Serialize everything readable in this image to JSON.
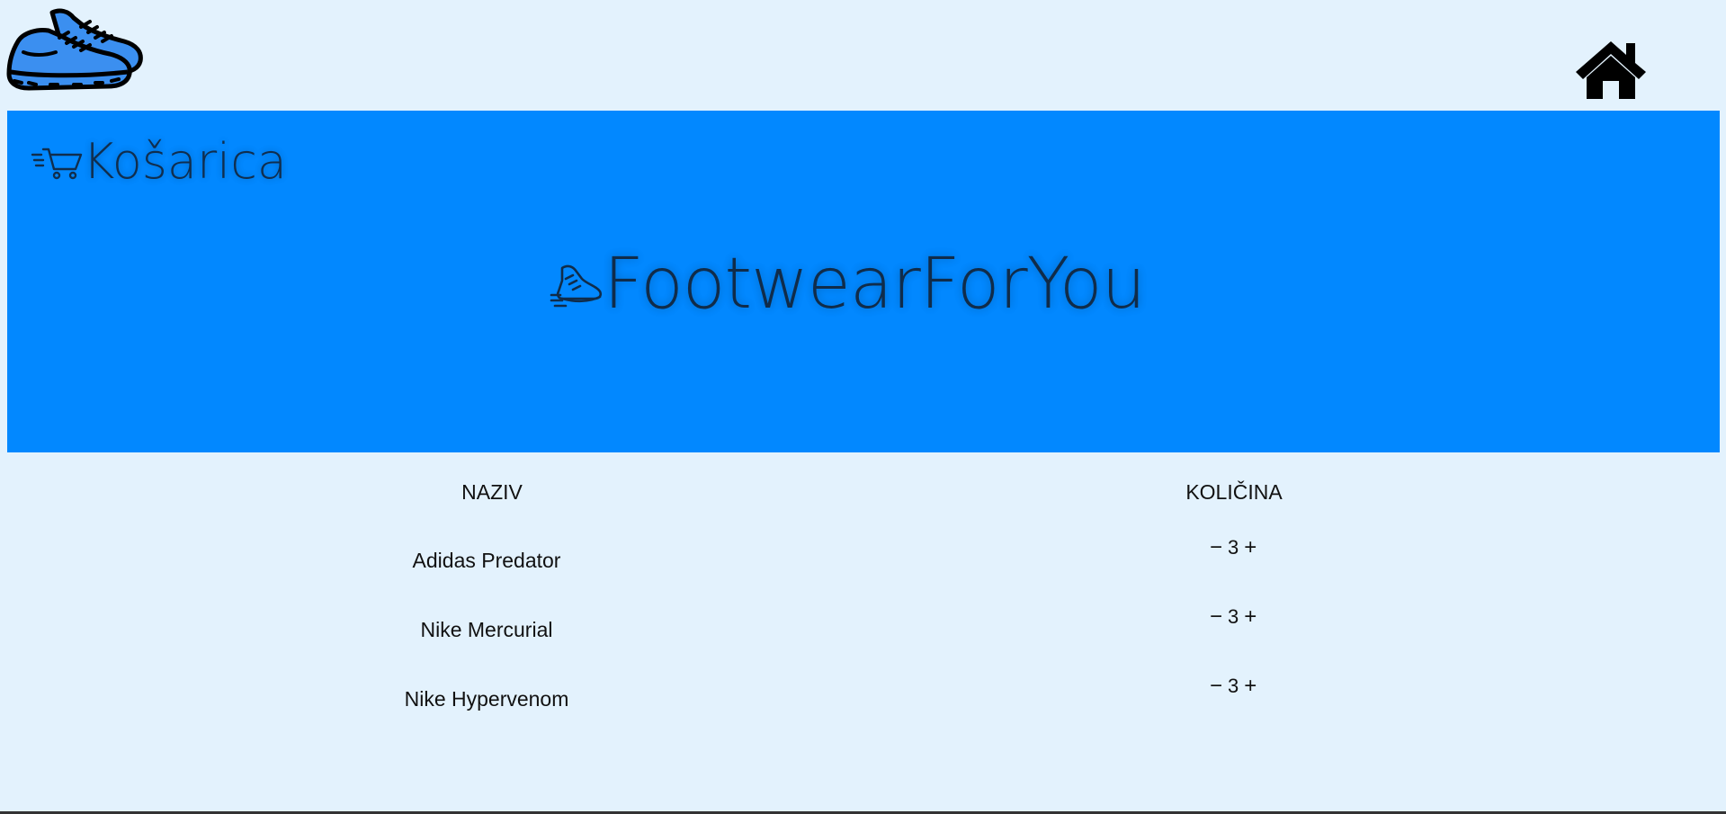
{
  "header": {
    "logo_icon": "sneakers-logo-icon",
    "home_icon": "home-icon"
  },
  "banner": {
    "background": "#0288ff",
    "cart_title": "Košarica",
    "cart_icon": "fast-cart-icon",
    "brand_title": "FootwearForYou",
    "brand_icon": "running-shoe-icon"
  },
  "cart": {
    "columns": [
      "NAZIV",
      "KOLIČINA"
    ],
    "rows": [
      {
        "name": "Adidas Predator",
        "quantity": "3",
        "minus": "−",
        "plus": "+"
      },
      {
        "name": "Nike Mercurial",
        "quantity": "3",
        "minus": "−",
        "plus": "+"
      },
      {
        "name": "Nike Hypervenom",
        "quantity": "3",
        "minus": "−",
        "plus": "+"
      }
    ]
  }
}
